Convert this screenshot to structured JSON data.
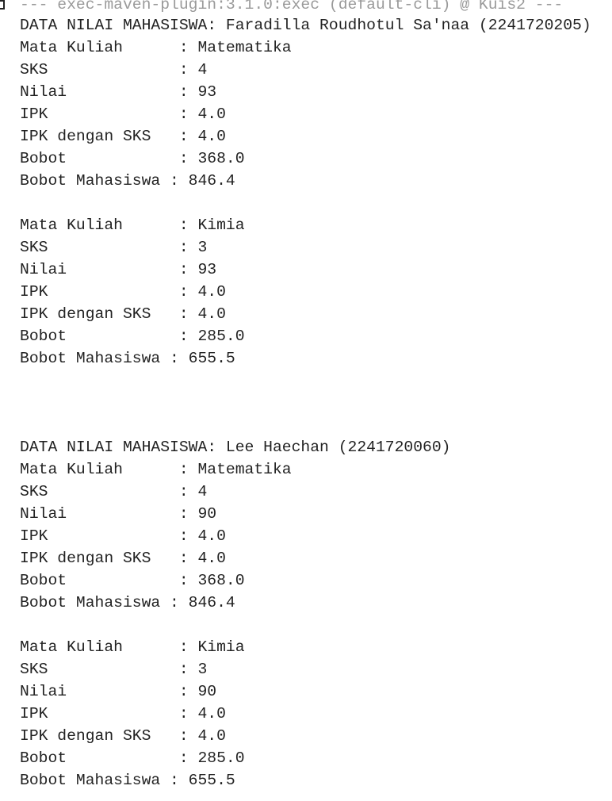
{
  "console": {
    "maven_header": "--- exec-maven-plugin:3.1.0:exec (default-cli) @ Kuis2 ---",
    "students": [
      {
        "header": "DATA NILAI MAHASISWA: Faradilla Roudhotul Sa'naa (2241720205)",
        "courses": [
          {
            "lines": [
              "Mata Kuliah      : Matematika",
              "SKS              : 4",
              "Nilai            : 93",
              "IPK              : 4.0",
              "IPK dengan SKS   : 4.0",
              "Bobot            : 368.0",
              "Bobot Mahasiswa : 846.4"
            ]
          },
          {
            "lines": [
              "Mata Kuliah      : Kimia",
              "SKS              : 3",
              "Nilai            : 93",
              "IPK              : 4.0",
              "IPK dengan SKS   : 4.0",
              "Bobot            : 285.0",
              "Bobot Mahasiswa : 655.5"
            ]
          }
        ]
      },
      {
        "header": "DATA NILAI MAHASISWA: Lee Haechan (2241720060)",
        "courses": [
          {
            "lines": [
              "Mata Kuliah      : Matematika",
              "SKS              : 4",
              "Nilai            : 90",
              "IPK              : 4.0",
              "IPK dengan SKS   : 4.0",
              "Bobot            : 368.0",
              "Bobot Mahasiswa : 846.4"
            ]
          },
          {
            "lines": [
              "Mata Kuliah      : Kimia",
              "SKS              : 3",
              "Nilai            : 90",
              "IPK              : 4.0",
              "IPK dengan SKS   : 4.0",
              "Bobot            : 285.0",
              "Bobot Mahasiswa : 655.5"
            ]
          }
        ]
      }
    ]
  }
}
